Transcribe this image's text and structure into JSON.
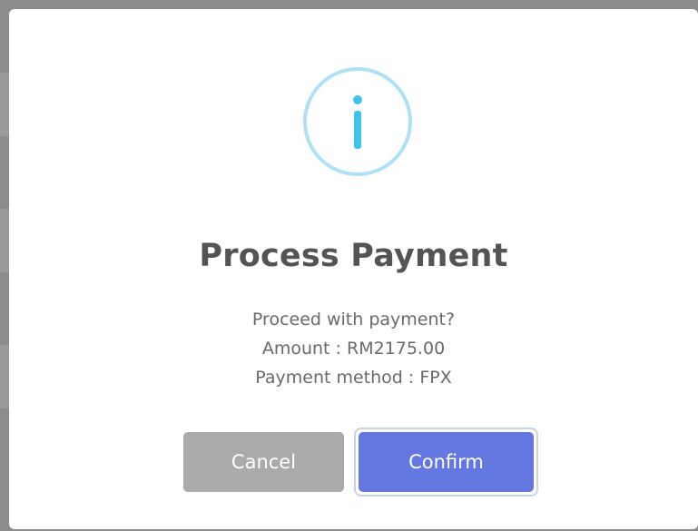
{
  "dialog": {
    "icon": "info-icon",
    "icon_colors": {
      "ring": "#aee1f7",
      "glyph": "#3fc3ee"
    },
    "title": "Process Payment",
    "message_lines": [
      "Proceed with payment?",
      "Amount : RM2175.00",
      "Payment method : FPX"
    ],
    "buttons": {
      "cancel_label": "Cancel",
      "confirm_label": "Confirm"
    },
    "colors": {
      "cancel": "#aaaaaa",
      "confirm": "#6478e1"
    }
  }
}
